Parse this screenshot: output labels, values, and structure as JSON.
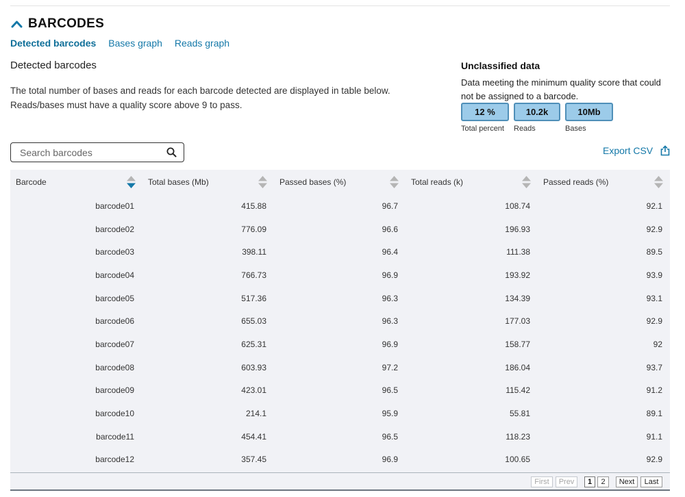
{
  "section": {
    "title": "BARCODES"
  },
  "tabs": [
    {
      "label": "Detected barcodes"
    },
    {
      "label": "Bases graph"
    },
    {
      "label": "Reads graph"
    }
  ],
  "detected": {
    "heading": "Detected barcodes",
    "line1": "The total number of bases and reads for each barcode detected are displayed in table below.",
    "line2": "Reads/bases must have a quality score above 9 to pass."
  },
  "unclassified": {
    "title": "Unclassified data",
    "line1": "Data meeting the minimum quality score that could",
    "line2": "not be assigned to a barcode.",
    "stats": [
      {
        "value": "12 %",
        "label": "Total percent"
      },
      {
        "value": "10.2k",
        "label": "Reads"
      },
      {
        "value": "10Mb",
        "label": "Bases"
      }
    ]
  },
  "search": {
    "placeholder": "Search barcodes"
  },
  "export": {
    "label": "Export CSV"
  },
  "table": {
    "columns": [
      "Barcode",
      "Total bases (Mb)",
      "Passed bases (%)",
      "Total reads (k)",
      "Passed reads (%)"
    ],
    "rows": [
      [
        "barcode01",
        "415.88",
        "96.7",
        "108.74",
        "92.1"
      ],
      [
        "barcode02",
        "776.09",
        "96.6",
        "196.93",
        "92.9"
      ],
      [
        "barcode03",
        "398.11",
        "96.4",
        "111.38",
        "89.5"
      ],
      [
        "barcode04",
        "766.73",
        "96.9",
        "193.92",
        "93.9"
      ],
      [
        "barcode05",
        "517.36",
        "96.3",
        "134.39",
        "93.1"
      ],
      [
        "barcode06",
        "655.03",
        "96.3",
        "177.03",
        "92.9"
      ],
      [
        "barcode07",
        "625.31",
        "96.9",
        "158.77",
        "92"
      ],
      [
        "barcode08",
        "603.93",
        "97.2",
        "186.04",
        "93.7"
      ],
      [
        "barcode09",
        "423.01",
        "96.5",
        "115.42",
        "91.2"
      ],
      [
        "barcode10",
        "214.1",
        "95.9",
        "55.81",
        "89.1"
      ],
      [
        "barcode11",
        "454.41",
        "96.5",
        "118.23",
        "91.1"
      ],
      [
        "barcode12",
        "357.45",
        "96.9",
        "100.65",
        "92.9"
      ]
    ]
  },
  "pager": {
    "first": "First",
    "prev": "Prev",
    "pages": [
      "1",
      "2"
    ],
    "next": "Next",
    "last": "Last"
  },
  "colors": {
    "accent": "#1478a8",
    "stat_fill": "#9ccbe9",
    "table_bg": "#f1f2f6"
  }
}
